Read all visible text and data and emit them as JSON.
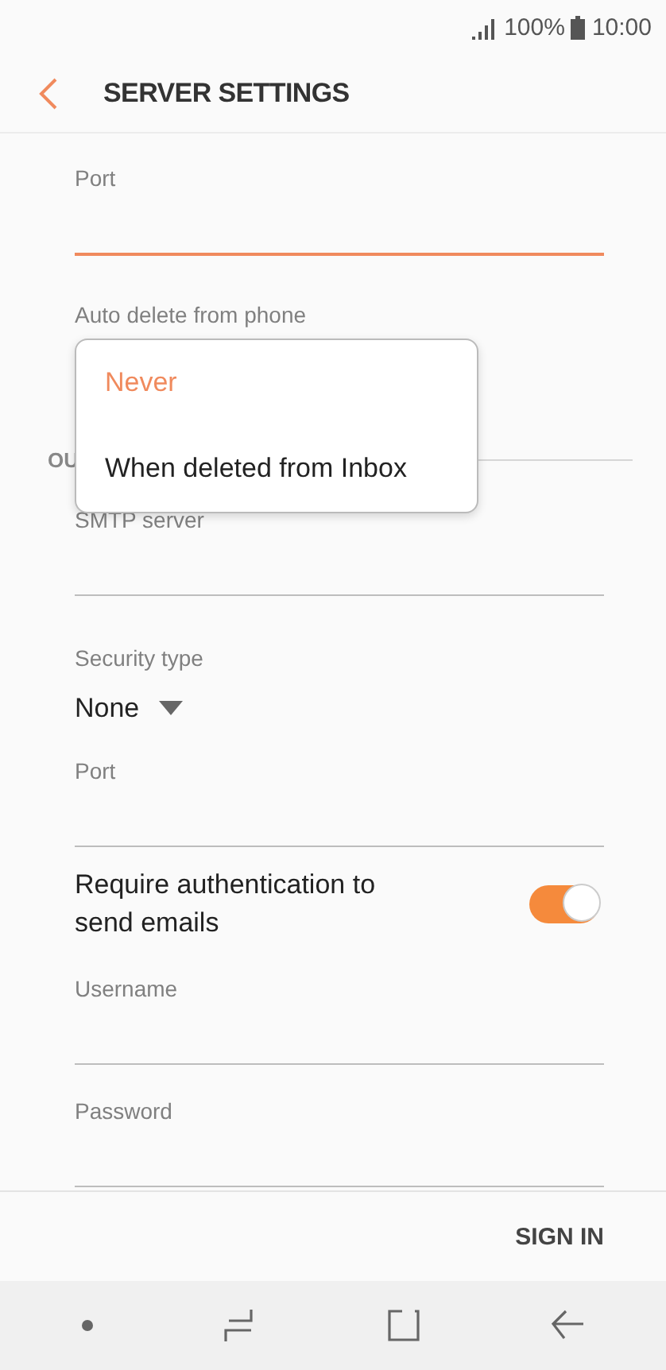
{
  "status_bar": {
    "battery": "100%",
    "time": "10:00"
  },
  "header": {
    "title": "SERVER SETTINGS"
  },
  "incoming": [
    {
      "kind": "field",
      "label": "Port",
      "focused": true
    },
    {
      "kind": "dropdown",
      "label": "Auto delete from phone"
    }
  ],
  "section": {
    "title": "OU"
  },
  "outgoing": [
    {
      "kind": "field",
      "label": "SMTP server",
      "focused": false
    },
    {
      "kind": "select",
      "label": "Security type",
      "value": "None"
    },
    {
      "kind": "field",
      "label": "Port",
      "focused": false
    },
    {
      "kind": "switch",
      "label": "Require authentication to send emails",
      "on": true
    },
    {
      "kind": "field",
      "label": "Username",
      "focused": false
    },
    {
      "kind": "field",
      "label": "Password",
      "focused": false
    }
  ],
  "popup": {
    "options": [
      {
        "label": "Never",
        "selected": true
      },
      {
        "label": "When deleted from Inbox",
        "selected": false
      }
    ]
  },
  "footer": {
    "button": "SIGN IN"
  }
}
